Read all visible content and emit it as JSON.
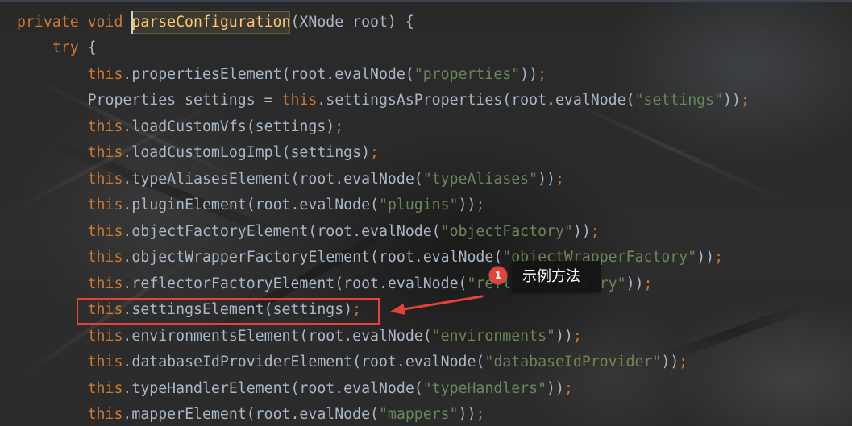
{
  "editor": {
    "theme": {
      "background": "#2B2B2B",
      "plain": "#A9B7C6",
      "keyword": "#CC7832",
      "declaration": "#FFC66D",
      "string": "#6A8759",
      "caret": "#CFCFCF"
    },
    "lines": [
      {
        "depth": 0,
        "tokens": [
          {
            "text": "private void ",
            "kind": "keyword"
          },
          {
            "text": "parseConfiguration",
            "kind": "declaration",
            "highlight": true,
            "caret": true
          },
          {
            "text": "(XNode root) {",
            "kind": "plain"
          }
        ]
      },
      {
        "depth": 1,
        "tokens": [
          {
            "text": "try",
            "kind": "keyword"
          },
          {
            "text": " {",
            "kind": "plain"
          }
        ]
      },
      {
        "depth": 2,
        "tokens": [
          {
            "text": "this",
            "kind": "keyword"
          },
          {
            "text": ".propertiesElement(root.evalNode(",
            "kind": "plain"
          },
          {
            "text": "\"properties\"",
            "kind": "string"
          },
          {
            "text": "))",
            "kind": "plain"
          },
          {
            "text": ";",
            "kind": "keyword"
          }
        ]
      },
      {
        "depth": 2,
        "tokens": [
          {
            "text": "Properties settings = ",
            "kind": "plain"
          },
          {
            "text": "this",
            "kind": "keyword"
          },
          {
            "text": ".settingsAsProperties(root.evalNode(",
            "kind": "plain"
          },
          {
            "text": "\"settings\"",
            "kind": "string"
          },
          {
            "text": "))",
            "kind": "plain"
          },
          {
            "text": ";",
            "kind": "keyword"
          }
        ]
      },
      {
        "depth": 2,
        "tokens": [
          {
            "text": "this",
            "kind": "keyword"
          },
          {
            "text": ".loadCustomVfs(settings)",
            "kind": "plain"
          },
          {
            "text": ";",
            "kind": "keyword"
          }
        ]
      },
      {
        "depth": 2,
        "tokens": [
          {
            "text": "this",
            "kind": "keyword"
          },
          {
            "text": ".loadCustomLogImpl(settings)",
            "kind": "plain"
          },
          {
            "text": ";",
            "kind": "keyword"
          }
        ]
      },
      {
        "depth": 2,
        "tokens": [
          {
            "text": "this",
            "kind": "keyword"
          },
          {
            "text": ".typeAliasesElement(root.evalNode(",
            "kind": "plain"
          },
          {
            "text": "\"typeAliases\"",
            "kind": "string"
          },
          {
            "text": "))",
            "kind": "plain"
          },
          {
            "text": ";",
            "kind": "keyword"
          }
        ]
      },
      {
        "depth": 2,
        "tokens": [
          {
            "text": "this",
            "kind": "keyword"
          },
          {
            "text": ".pluginElement(root.evalNode(",
            "kind": "plain"
          },
          {
            "text": "\"plugins\"",
            "kind": "string"
          },
          {
            "text": "))",
            "kind": "plain"
          },
          {
            "text": ";",
            "kind": "keyword"
          }
        ]
      },
      {
        "depth": 2,
        "tokens": [
          {
            "text": "this",
            "kind": "keyword"
          },
          {
            "text": ".objectFactoryElement(root.evalNode(",
            "kind": "plain"
          },
          {
            "text": "\"objectFactory\"",
            "kind": "string"
          },
          {
            "text": "))",
            "kind": "plain"
          },
          {
            "text": ";",
            "kind": "keyword"
          }
        ]
      },
      {
        "depth": 2,
        "tokens": [
          {
            "text": "this",
            "kind": "keyword"
          },
          {
            "text": ".objectWrapperFactoryElement(root.evalNode(",
            "kind": "plain"
          },
          {
            "text": "\"objectWrapperFactory\"",
            "kind": "string"
          },
          {
            "text": "))",
            "kind": "plain"
          },
          {
            "text": ";",
            "kind": "keyword"
          }
        ]
      },
      {
        "depth": 2,
        "tokens": [
          {
            "text": "this",
            "kind": "keyword"
          },
          {
            "text": ".reflectorFactoryElement(root.evalNode(",
            "kind": "plain"
          },
          {
            "text": "\"reflectorFactory\"",
            "kind": "string"
          },
          {
            "text": "))",
            "kind": "plain"
          },
          {
            "text": ";",
            "kind": "keyword"
          }
        ]
      },
      {
        "depth": 2,
        "annotated": true,
        "tokens": [
          {
            "text": "this",
            "kind": "keyword"
          },
          {
            "text": ".settingsElement(settings)",
            "kind": "plain"
          },
          {
            "text": ";",
            "kind": "keyword"
          }
        ]
      },
      {
        "depth": 2,
        "tokens": [
          {
            "text": "this",
            "kind": "keyword"
          },
          {
            "text": ".environmentsElement(root.evalNode(",
            "kind": "plain"
          },
          {
            "text": "\"environments\"",
            "kind": "string"
          },
          {
            "text": "))",
            "kind": "plain"
          },
          {
            "text": ";",
            "kind": "keyword"
          }
        ]
      },
      {
        "depth": 2,
        "tokens": [
          {
            "text": "this",
            "kind": "keyword"
          },
          {
            "text": ".databaseIdProviderElement(root.evalNode(",
            "kind": "plain"
          },
          {
            "text": "\"databaseIdProvider\"",
            "kind": "string"
          },
          {
            "text": "))",
            "kind": "plain"
          },
          {
            "text": ";",
            "kind": "keyword"
          }
        ]
      },
      {
        "depth": 2,
        "tokens": [
          {
            "text": "this",
            "kind": "keyword"
          },
          {
            "text": ".typeHandlerElement(root.evalNode(",
            "kind": "plain"
          },
          {
            "text": "\"typeHandlers\"",
            "kind": "string"
          },
          {
            "text": "))",
            "kind": "plain"
          },
          {
            "text": ";",
            "kind": "keyword"
          }
        ]
      },
      {
        "depth": 2,
        "tokens": [
          {
            "text": "this",
            "kind": "keyword"
          },
          {
            "text": ".mapperElement(root.evalNode(",
            "kind": "plain"
          },
          {
            "text": "\"mappers\"",
            "kind": "string"
          },
          {
            "text": "))",
            "kind": "plain"
          },
          {
            "text": ";",
            "kind": "keyword"
          }
        ]
      }
    ]
  },
  "annotation": {
    "badge": "1",
    "label": "示例方法",
    "color": "#E8403A"
  }
}
